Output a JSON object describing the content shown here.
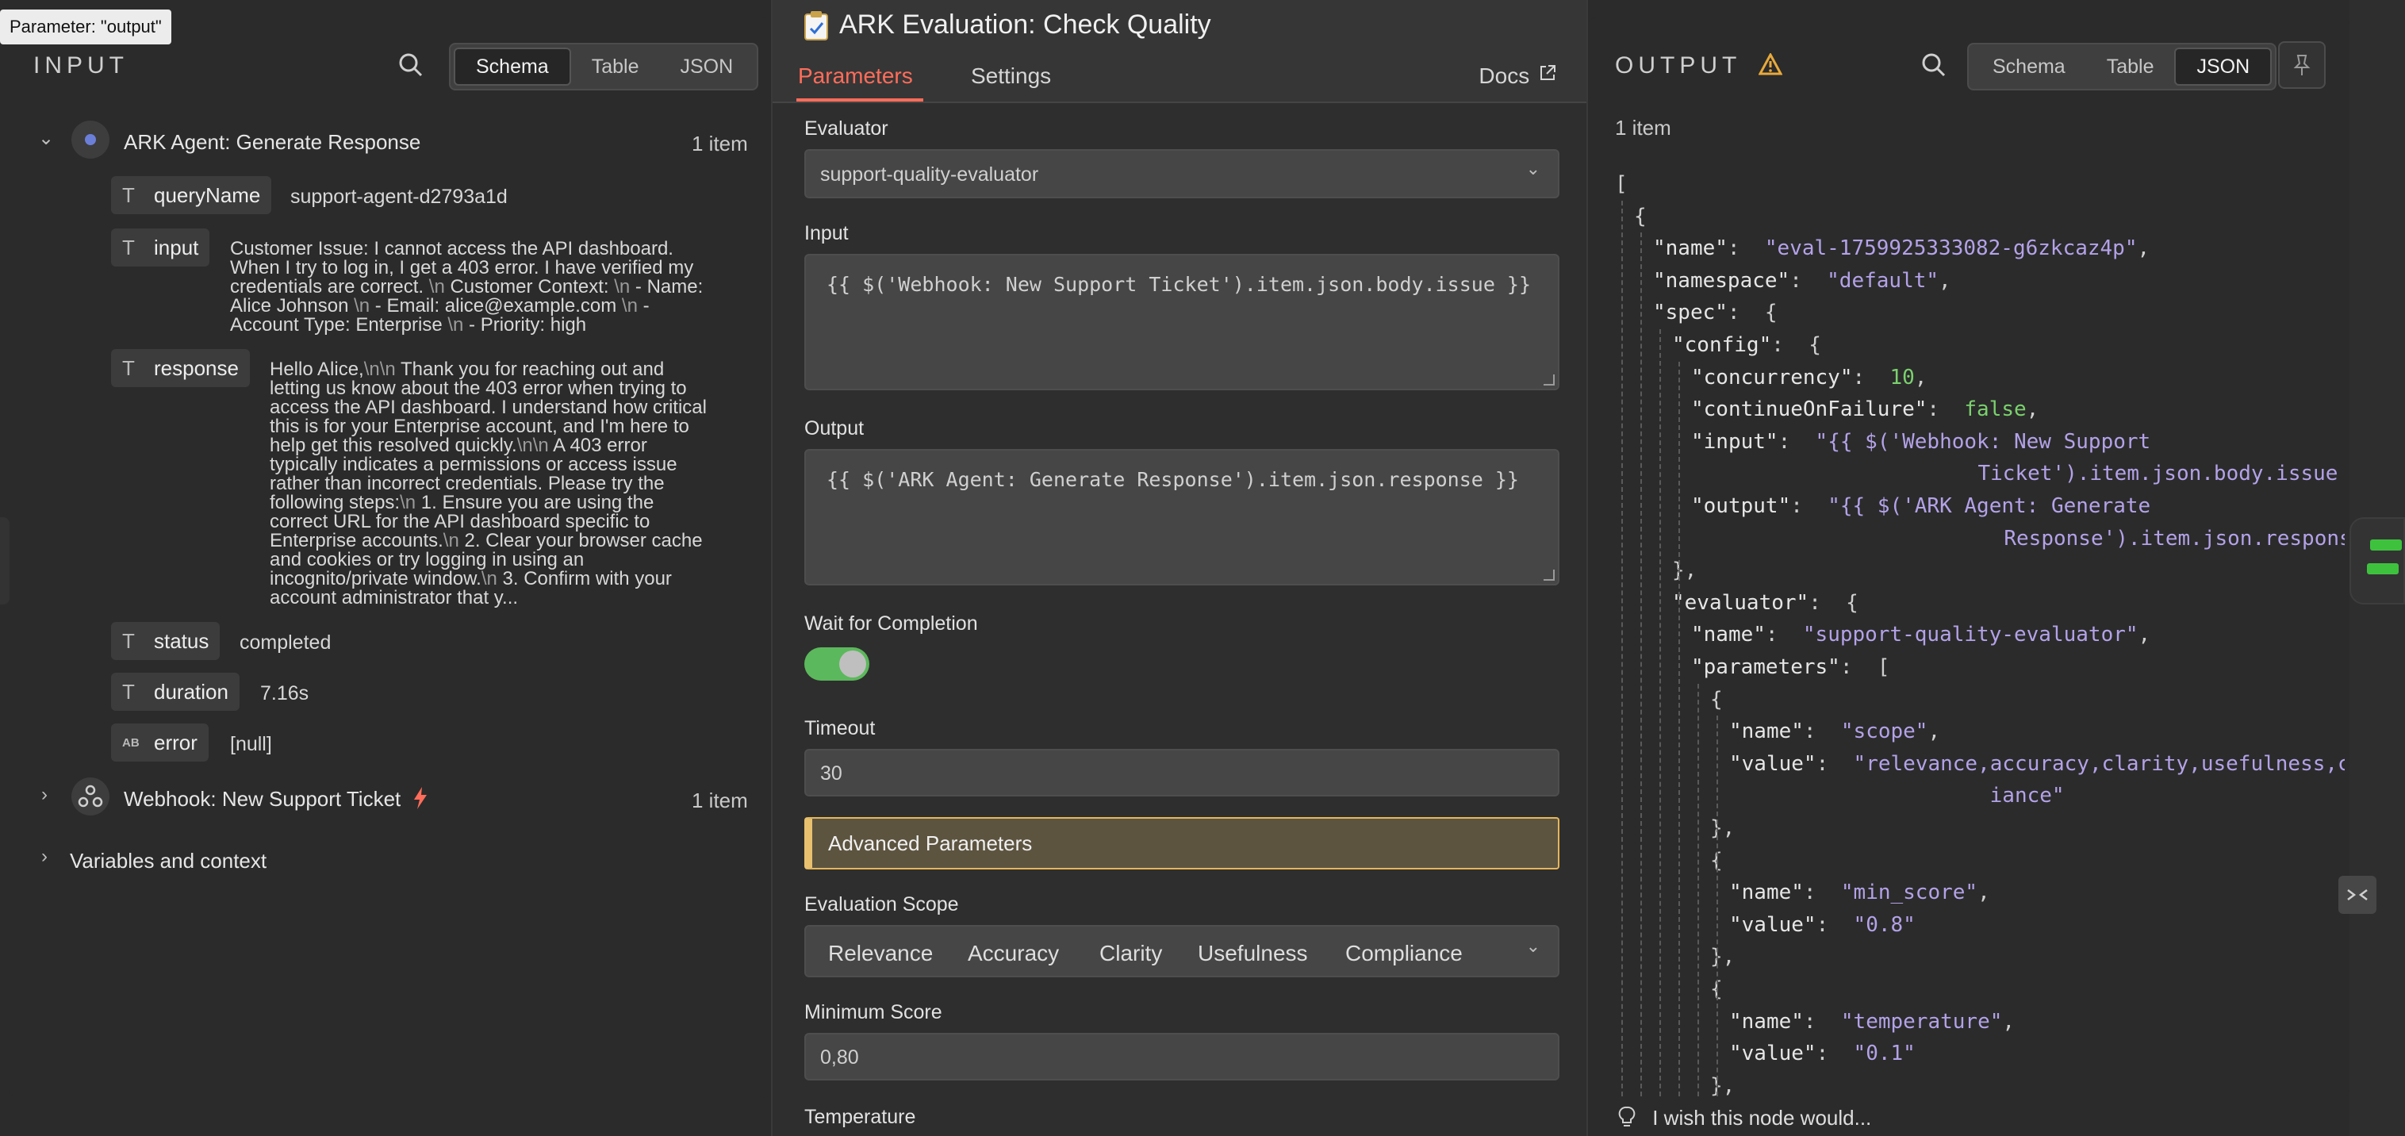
{
  "tooltip": "Parameter: \"output\"",
  "input_panel": {
    "title": "INPUT",
    "view_options": [
      "Schema",
      "Table",
      "JSON"
    ],
    "active_view": "Schema",
    "node1": {
      "name": "ARK Agent: Generate Response",
      "count": "1 item",
      "fields": {
        "queryName": {
          "label": "queryName",
          "value": "support-agent-d2793a1d"
        },
        "input": {
          "label": "input",
          "lines": [
            [
              "Customer Issue: I cannot access the API dashboard."
            ],
            [
              "When I try to log in, I get a 403 error. I have verified my"
            ],
            [
              "credentials are correct. ",
              "\\n",
              " Customer Context: ",
              "\\n",
              " - Name:"
            ],
            [
              "Alice Johnson ",
              "\\n",
              " - Email: alice@example.com ",
              "\\n",
              " -"
            ],
            [
              "Account Type: Enterprise ",
              "\\n",
              " - Priority: high"
            ]
          ]
        },
        "response": {
          "label": "response",
          "lines": [
            [
              "Hello Alice,",
              "\\n",
              "\\n",
              " Thank you for reaching out and"
            ],
            [
              "letting us know about the 403 error when trying to"
            ],
            [
              "access the API dashboard. I understand how critical"
            ],
            [
              "this is for your Enterprise account, and I'm here to"
            ],
            [
              "help get this resolved quickly.",
              "\\n",
              "\\n",
              " A 403 error"
            ],
            [
              "typically indicates a permissions or access issue"
            ],
            [
              "rather than incorrect credentials. Please try the"
            ],
            [
              "following steps:",
              "\\n",
              " 1. Ensure you are using the"
            ],
            [
              "correct URL for the API dashboard specific to"
            ],
            [
              "Enterprise accounts.",
              "\\n",
              " 2. Clear your browser cache"
            ],
            [
              "and cookies or try logging in using an"
            ],
            [
              "incognito/private window.",
              "\\n",
              " 3. Confirm with your"
            ],
            [
              "account administrator that y..."
            ]
          ]
        },
        "status": {
          "label": "status",
          "value": "completed"
        },
        "duration": {
          "label": "duration",
          "value": "7.16s"
        },
        "error": {
          "label": "error",
          "value": "[null]"
        }
      }
    },
    "node2": {
      "name": "Webhook: New Support Ticket",
      "count": "1 item"
    },
    "variables": "Variables and context"
  },
  "center_panel": {
    "title": "ARK Evaluation: Check Quality",
    "tabs": {
      "parameters": "Parameters",
      "settings": "Settings",
      "docs": "Docs"
    },
    "evaluator": {
      "label": "Evaluator",
      "value": "support-quality-evaluator"
    },
    "input": {
      "label": "Input",
      "value": "{{ $('Webhook: New Support Ticket').item.json.body.issue }}"
    },
    "output": {
      "label": "Output",
      "value": "{{ $('ARK Agent: Generate Response').item.json.response }}"
    },
    "wait": {
      "label": "Wait for Completion",
      "enabled": true
    },
    "timeout": {
      "label": "Timeout",
      "value": "30"
    },
    "advanced": "Advanced Parameters",
    "scope": {
      "label": "Evaluation Scope",
      "options": [
        "Relevance",
        "Accuracy",
        "Clarity",
        "Usefulness",
        "Compliance"
      ]
    },
    "min_score": {
      "label": "Minimum Score",
      "value": "0,80"
    },
    "temperature": {
      "label": "Temperature"
    }
  },
  "output_panel": {
    "title": "OUTPUT",
    "view_options": [
      "Schema",
      "Table",
      "JSON"
    ],
    "active_view": "JSON",
    "count": "1 item",
    "json_lines": [
      {
        "d": 0,
        "p": "["
      },
      {
        "d": 1,
        "p": "{"
      },
      {
        "d": 2,
        "k": "\"name\"",
        "s": "\"eval-1759925333082-g6zkcaz4p\"",
        "e": ","
      },
      {
        "d": 2,
        "k": "\"namespace\"",
        "s": "\"default\"",
        "e": ","
      },
      {
        "d": 2,
        "k": "\"spec\"",
        "p": "{"
      },
      {
        "d": 3,
        "k": "\"config\"",
        "p": "{"
      },
      {
        "d": 4,
        "k": "\"concurrency\"",
        "n": "10",
        "e": ","
      },
      {
        "d": 4,
        "k": "\"continueOnFailure\"",
        "n": "false",
        "e": ","
      },
      {
        "d": 4,
        "k": "\"input\"",
        "s": "\"{{ $('Webhook: New Support"
      },
      {
        "d": 4,
        "cont": 11,
        "s": "Ticket').item.json.body.issue }}\"",
        "e": ","
      },
      {
        "d": 4,
        "k": "\"output\"",
        "s": "\"{{ $('ARK Agent: Generate"
      },
      {
        "d": 4,
        "cont": 12,
        "s": "Response').item.json.response }}\""
      },
      {
        "d": 3,
        "p": "},"
      },
      {
        "d": 3,
        "k": "\"evaluator\"",
        "p": "{"
      },
      {
        "d": 4,
        "k": "\"name\"",
        "s": "\"support-quality-evaluator\"",
        "e": ","
      },
      {
        "d": 4,
        "k": "\"parameters\"",
        "p": "["
      },
      {
        "d": 5,
        "p": "{"
      },
      {
        "d": 6,
        "k": "\"name\"",
        "s": "\"scope\"",
        "e": ","
      },
      {
        "d": 6,
        "k": "\"value\"",
        "s": "\"relevance,accuracy,clarity,usefulness,compl"
      },
      {
        "d": 6,
        "cont": 10,
        "s": "iance\""
      },
      {
        "d": 5,
        "p": "},"
      },
      {
        "d": 5,
        "p": "{"
      },
      {
        "d": 6,
        "k": "\"name\"",
        "s": "\"min_score\"",
        "e": ","
      },
      {
        "d": 6,
        "k": "\"value\"",
        "s": "\"0.8\""
      },
      {
        "d": 5,
        "p": "},"
      },
      {
        "d": 5,
        "p": "{"
      },
      {
        "d": 6,
        "k": "\"name\"",
        "s": "\"temperature\"",
        "e": ","
      },
      {
        "d": 6,
        "k": "\"value\"",
        "s": "\"0.1\""
      },
      {
        "d": 5,
        "p": "},"
      }
    ]
  },
  "footer": {
    "wish": "I wish this node would..."
  },
  "colors": {
    "accent": "#ff6d5a",
    "toggle_on": "#5cb85c",
    "warning": "#e8c06e",
    "json_string": "#b3a2e8",
    "json_number": "#7bd16e"
  },
  "icons": [
    "search-icon",
    "chevron-down-icon",
    "chevron-right-icon",
    "text-type-icon",
    "abc-type-icon",
    "webhook-icon",
    "bolt-icon",
    "warning-icon",
    "pin-icon",
    "external-link-icon",
    "lightbulb-icon",
    "clipboard-icon",
    "collapse-icon"
  ]
}
